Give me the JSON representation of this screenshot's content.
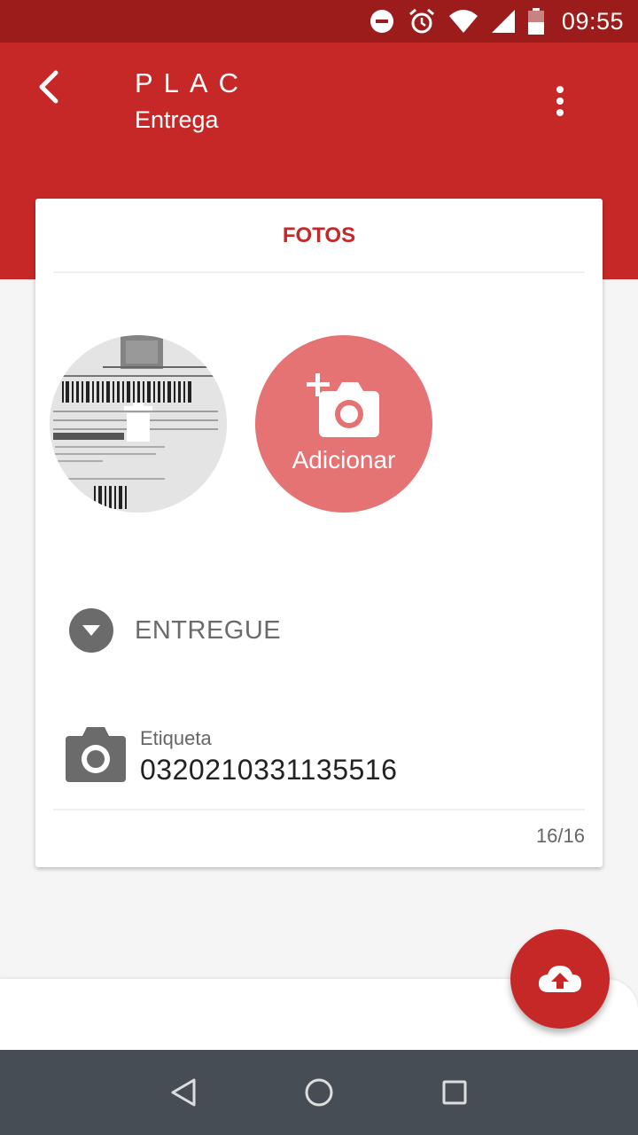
{
  "status_bar": {
    "time": "09:55",
    "icons": [
      "do-not-disturb-icon",
      "alarm-icon",
      "wifi-icon",
      "signal-icon",
      "battery-icon"
    ]
  },
  "app_bar": {
    "title": "PLAC",
    "subtitle": "Entrega",
    "back_icon": "back-arrow-icon",
    "menu_icon": "more-vert-icon"
  },
  "card": {
    "header": "FOTOS",
    "photos": [
      {
        "type": "photo",
        "icon": "trash-icon"
      }
    ],
    "add_photo_label": "Adicionar",
    "status": "ENTREGUE",
    "label_caption": "Etiqueta",
    "label_value": "0320210331135516",
    "counter": "16/16"
  },
  "fab": {
    "icon": "cloud-upload-icon"
  },
  "nav": {
    "icons": [
      "back-triangle-icon",
      "home-circle-icon",
      "recents-square-icon"
    ]
  },
  "colors": {
    "primary": "#c62828",
    "status_bar": "#9c1c1c",
    "add_photo": "#e57373",
    "nav_bar": "#474d55"
  }
}
